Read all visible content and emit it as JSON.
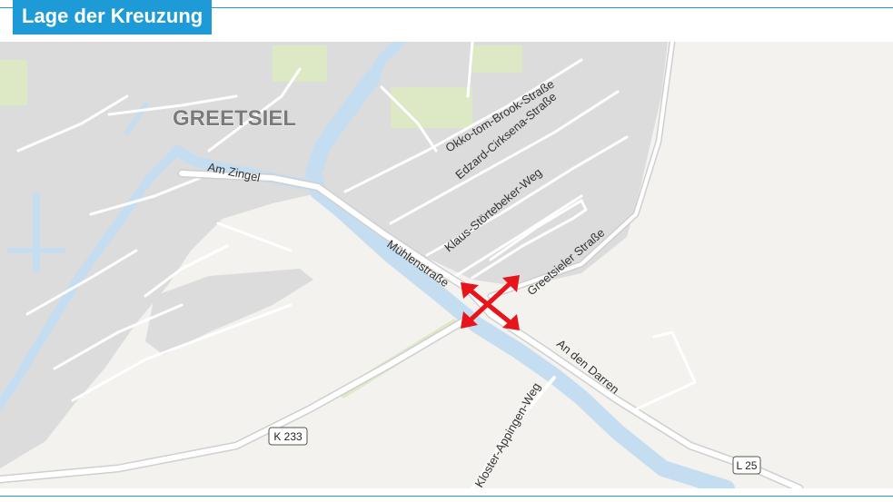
{
  "header": {
    "title": "Lage der Kreuzung"
  },
  "colors": {
    "accent": "#1e9bd7",
    "land": "#f3f2ee",
    "town": "#dcdcdc",
    "water": "#c5ddf0",
    "road": "#ffffff",
    "green": "#dde9c5",
    "marker": "#e8141c"
  },
  "map": {
    "town_label": "GREETSIEL",
    "streets": {
      "okko": "Okko-tom-Brook-Straße",
      "edzard": "Edzard-Cirksena-Straße",
      "klaus": "Klaus-Störtebeker-Weg",
      "greetsieler": "Greetsieler Straße",
      "muehlen": "Mühlenstraße",
      "zingel": "Am Zingel",
      "darren": "An den Darren",
      "kloster": "Kloster-Appingen-Weg"
    },
    "road_shields": {
      "k233": "K 233",
      "l25": "L 25"
    },
    "marker_icon": "four-way-arrows-icon"
  }
}
